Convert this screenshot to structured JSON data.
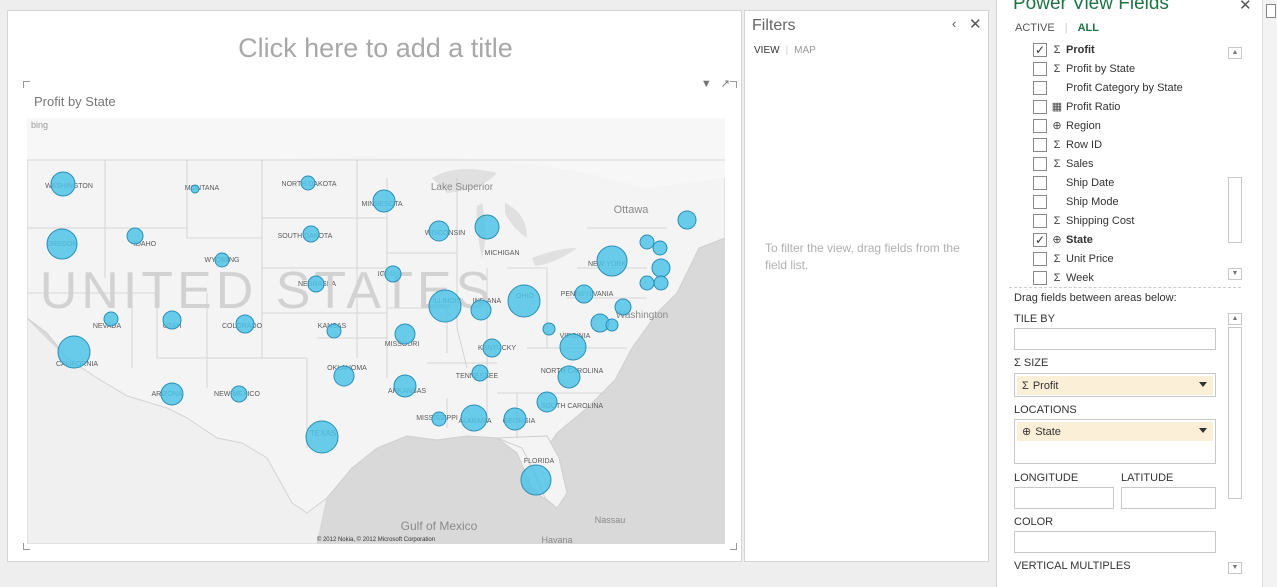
{
  "report": {
    "title_placeholder": "Click here to add a title",
    "viz_title": "Profit by State",
    "copyright": "© 2012 Nokia, © 2012 Microsoft Corporation",
    "bing_logo": "bing",
    "map_labels": [
      "WASHINGTON",
      "MONTANA",
      "NORTH DAKOTA",
      "MINNESOTA",
      "SOUTH DAKOTA",
      "OREGON",
      "IDAHO",
      "WYOMING",
      "WISCONSIN",
      "MICHIGAN",
      "IOWA",
      "NEBRASKA",
      "NEVADA",
      "UTAH",
      "COLORADO",
      "KANSAS",
      "ILLINOIS",
      "INDIANA",
      "OHIO",
      "MISSOURI",
      "PENNSYLVANIA",
      "NEW YORK",
      "CALIFORNIA",
      "OKLAHOMA",
      "TENNESSEE",
      "ARKANSAS",
      "ARIZONA",
      "NEW MEXICO",
      "TEXAS",
      "MISSISSIPPI",
      "ALABAMA",
      "GEORGIA",
      "SOUTH CAROLINA",
      "NORTH CAROLINA",
      "VIRGINIA",
      "KENTUCKY",
      "FLORIDA",
      "UNITED STATES",
      "Gulf of Mexico",
      "Ottawa",
      "Lake Superior",
      "Washington",
      "Nassau",
      "Havana"
    ]
  },
  "filters": {
    "title": "Filters",
    "collapse_icon": "chevron-left-icon",
    "close_icon": "close-icon",
    "tab_view": "VIEW",
    "tab_map": "MAP",
    "hint": "To filter the view, drag fields from the field list."
  },
  "fields": {
    "title": "Power View Fields",
    "tab_active": "ACTIVE",
    "tab_all": "ALL",
    "list": [
      {
        "name": "Profit",
        "checked": true,
        "icon": "sigma",
        "bold": true
      },
      {
        "name": "Profit by State",
        "checked": false,
        "icon": "sigma",
        "bold": false
      },
      {
        "name": "Profit Category by State",
        "checked": false,
        "icon": "none",
        "bold": false
      },
      {
        "name": "Profit Ratio",
        "checked": false,
        "icon": "calc",
        "bold": false
      },
      {
        "name": "Region",
        "checked": false,
        "icon": "globe",
        "bold": false
      },
      {
        "name": "Row ID",
        "checked": false,
        "icon": "sigma",
        "bold": false
      },
      {
        "name": "Sales",
        "checked": false,
        "icon": "sigma",
        "bold": false
      },
      {
        "name": "Ship Date",
        "checked": false,
        "icon": "none",
        "bold": false
      },
      {
        "name": "Ship Mode",
        "checked": false,
        "icon": "none",
        "bold": false
      },
      {
        "name": "Shipping Cost",
        "checked": false,
        "icon": "sigma",
        "bold": false
      },
      {
        "name": "State",
        "checked": true,
        "icon": "globe",
        "bold": true
      },
      {
        "name": "Unit Price",
        "checked": false,
        "icon": "sigma",
        "bold": false
      },
      {
        "name": "Week",
        "checked": false,
        "icon": "sigma",
        "bold": false
      }
    ],
    "drag_hint": "Drag fields between areas below:",
    "areas": {
      "tile_by": "TILE BY",
      "size": "SIZE",
      "size_field": "Profit",
      "locations": "LOCATIONS",
      "locations_field": "State",
      "longitude": "LONGITUDE",
      "latitude": "LATITUDE",
      "color": "COLOR",
      "vertical_multiples": "VERTICAL MULTIPLES"
    }
  },
  "colors": {
    "bubble": "#4fc3e6",
    "bubble_stroke": "#2b8fb5",
    "accent": "#217346"
  }
}
